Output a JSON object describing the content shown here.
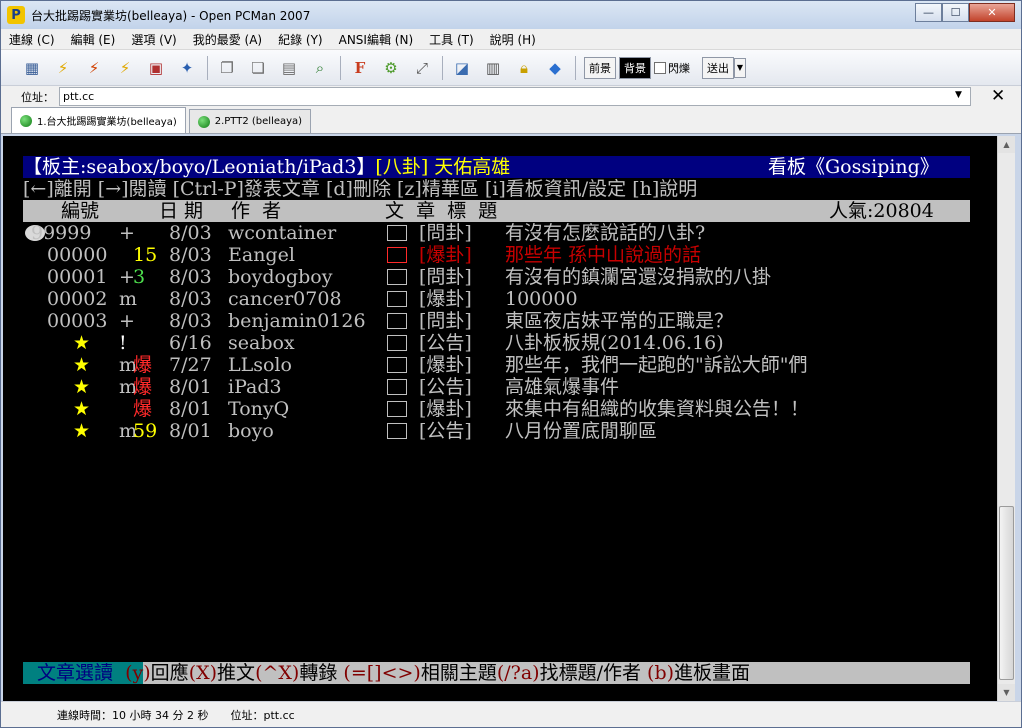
{
  "window": {
    "title": "台大批踢踢實業坊(belleaya) - Open PCMan 2007",
    "app_icon": "pcman-icon",
    "controls": {
      "minimize": "—",
      "maximize": "☐",
      "close": "✕"
    }
  },
  "menu": [
    "連線 (C)",
    "編輯 (E)",
    "選項 (V)",
    "我的最愛 (A)",
    "紀錄 (Y)",
    "ANSI編輯 (N)",
    "工具 (T)",
    "說明 (H)"
  ],
  "toolbar": {
    "icons": [
      "address-book-icon",
      "connect-icon",
      "disconnect-icon",
      "reconnect-icon",
      "close-connection-icon",
      "add-favorite-icon",
      "copy-icon",
      "paste-icon",
      "paste-ansi-icon",
      "find-icon",
      "font-icon",
      "settings-icon",
      "fullscreen-icon",
      "minimize-to-tray-icon",
      "ansi-editor-icon",
      "lock-icon",
      "pcman-icon"
    ],
    "fg_label": "前景",
    "bg_label": "背景",
    "blink_label": "閃爍",
    "send_label": "送出"
  },
  "address": {
    "label": "位址：",
    "value": "ptt.cc"
  },
  "tabs": [
    {
      "label": "1.台大批踢踢實業坊(belleaya)",
      "active": true
    },
    {
      "label": "2.PTT2 (belleaya)",
      "active": false
    }
  ],
  "terminal": {
    "header": {
      "moderators": "【板主:seabox/boyo/Leoniath/iPad3】",
      "category": "[八卦] 天佑高雄",
      "board": "看板《Gossiping》"
    },
    "keys_line": "[←]離開 [→]閱讀 [Ctrl-P]發表文章 [d]刪除 [z]精華區 [i]看板資訊/設定 [h]說明",
    "columns": {
      "number": "編號",
      "date": "日 期",
      "author": "作  者",
      "title": "文  章  標  題",
      "popularity": "人氣:20804"
    },
    "posts": [
      {
        "num": "99999",
        "mark": "+",
        "push": "",
        "date": "8/03",
        "author": "wcontainer",
        "cat": "[問卦]",
        "title": "有沒有怎麼說話的八卦?",
        "style": "normal"
      },
      {
        "num": "00000",
        "mark": "",
        "push": "15",
        "date": "8/03",
        "author": "Eangel",
        "cat": "[爆卦]",
        "title": "那些年 孫中山說過的話",
        "style": "red"
      },
      {
        "num": "00001",
        "mark": "+",
        "push": "3",
        "date": "8/03",
        "author": "boydogboy",
        "cat": "[問卦]",
        "title": "有沒有的鎮瀾宮還沒捐款的八掛",
        "style": "normal"
      },
      {
        "num": "00002",
        "mark": "m",
        "push": "",
        "date": "8/03",
        "author": "cancer0708",
        "cat": "[爆卦]",
        "title": "100000",
        "style": "normal"
      },
      {
        "num": "00003",
        "mark": "+",
        "push": "",
        "date": "8/03",
        "author": "benjamin0126",
        "cat": "[問卦]",
        "title": "東區夜店妹平常的正職是？",
        "style": "normal"
      },
      {
        "num": "★",
        "mark": "!",
        "push": "",
        "date": "6/16",
        "author": "seabox",
        "cat": "[公告]",
        "title": "八卦板板規(2014.06.16)",
        "style": "sticky"
      },
      {
        "num": "★",
        "mark": "m",
        "push": "爆",
        "date": "7/27",
        "author": "LLsolo",
        "cat": "[爆卦]",
        "title": "那些年，我們一起跑的\"訴訟大師\"們",
        "style": "sticky"
      },
      {
        "num": "★",
        "mark": "m",
        "push": "爆",
        "date": "8/01",
        "author": "iPad3",
        "cat": "[公告]",
        "title": "高雄氣爆事件",
        "style": "sticky"
      },
      {
        "num": "★",
        "mark": "",
        "push": "爆",
        "date": "8/01",
        "author": "TonyQ",
        "cat": "[爆卦]",
        "title": "來集中有組織的收集資料與公告！！",
        "style": "sticky"
      },
      {
        "num": "★",
        "mark": "m",
        "push": "59",
        "date": "8/01",
        "author": "boyo",
        "cat": "[公告]",
        "title": "八月份置底閒聊區",
        "style": "sticky"
      }
    ],
    "footer": {
      "mode": "文章選讀",
      "reply_key": "(y)",
      "reply": "回應",
      "push_key": "(X)",
      "push": "推文",
      "repost_key": "(^X)",
      "repost": "轉錄",
      "thread_key": "(=[]<>)",
      "thread": "相關主題",
      "search_key": "(/?a)",
      "search": "找標題/作者",
      "enter_key": "(b)",
      "enter": "進板畫面"
    }
  },
  "status": {
    "connection_time": "連線時間：10 小時 34 分 2 秒",
    "address": "位址：ptt.cc"
  }
}
